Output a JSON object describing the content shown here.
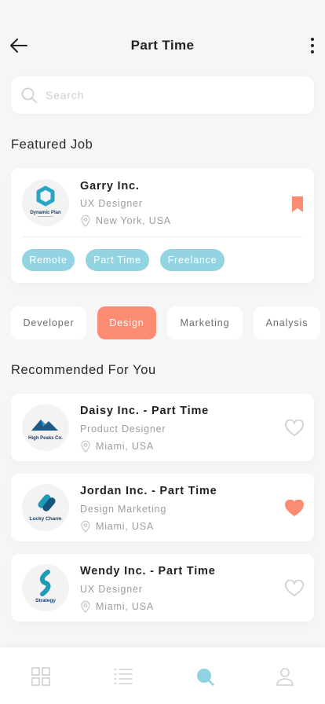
{
  "header": {
    "title": "Part Time",
    "back_icon": "arrow-left-icon",
    "more_icon": "more-vertical-icon"
  },
  "search": {
    "placeholder": "Search",
    "value": "",
    "icon": "search-icon"
  },
  "featured": {
    "section_title": "Featured Job",
    "job": {
      "company": "Garry Inc.",
      "role": "UX Designer",
      "location": "New York, USA",
      "logo_text": "Dynamic Plan",
      "bookmarked": true,
      "tags": [
        "Remote",
        "Part Time",
        "Freelance"
      ]
    }
  },
  "categories": {
    "items": [
      "Developer",
      "Design",
      "Marketing",
      "Analysis"
    ],
    "selected": "Design"
  },
  "recommended": {
    "section_title": "Recommended For You",
    "jobs": [
      {
        "company": "Daisy Inc. - Part Time",
        "role": "Product Designer",
        "location": "Miami, USA",
        "logo_text": "High Peaks Co.",
        "favorited": false
      },
      {
        "company": "Jordan Inc. - Part Time",
        "role": "Design Marketing",
        "location": "Miami, USA",
        "logo_text": "Lucky Charm",
        "favorited": true
      },
      {
        "company": "Wendy Inc. - Part Time",
        "role": "UX Designer",
        "location": "Miami, USA",
        "logo_text": "Strategy",
        "favorited": false
      }
    ]
  },
  "bottom_nav": {
    "items": [
      "grid-icon",
      "list-icon",
      "search-icon",
      "profile-icon"
    ],
    "active": "search-icon"
  },
  "colors": {
    "accent": "#fb8b72",
    "tag": "#93d4e2",
    "active_nav": "#8fd3e3",
    "inactive_nav": "#cfcfcf"
  }
}
